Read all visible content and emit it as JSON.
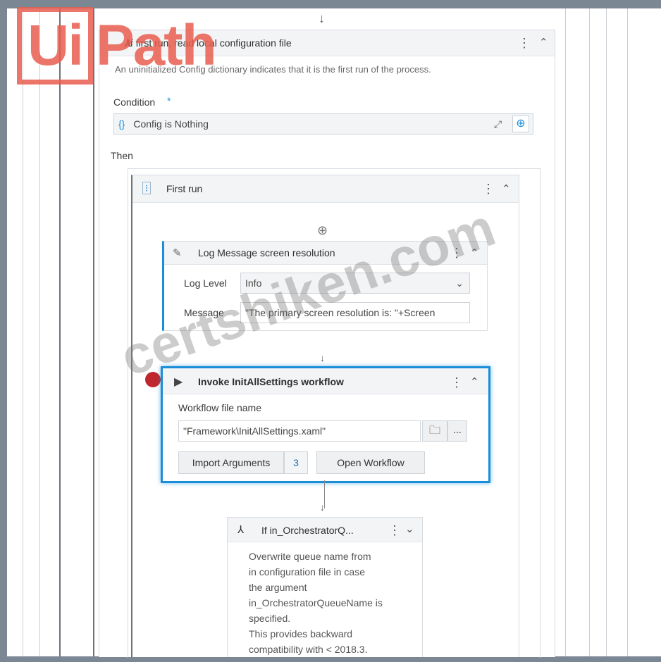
{
  "if_block": {
    "title": "If first run, read local configuration file",
    "description": "An uninitialized Config dictionary indicates that it is the first run of the process.",
    "condition_label": "Condition",
    "required_mark": "*",
    "condition_value": "Config is Nothing",
    "then_label": "Then"
  },
  "sequence": {
    "title": "First run"
  },
  "log_message": {
    "title": "Log Message screen resolution",
    "log_level_label": "Log Level",
    "log_level_value": "Info",
    "message_label": "Message",
    "message_value": "\"The primary screen resolution is: \"+Screen"
  },
  "invoke": {
    "title": "Invoke InitAllSettings workflow",
    "file_label": "Workflow file name",
    "file_value": "\"Framework\\InitAllSettings.xaml\"",
    "browse_label": "...",
    "import_label": "Import Arguments",
    "import_count": "3",
    "open_label": "Open Workflow"
  },
  "if_orchestrator": {
    "title": "If in_OrchestratorQ...",
    "description_lines": [
      "Overwrite queue name from",
      "in configuration file in case",
      "the argument",
      "in_OrchestratorQueueName is",
      "specified.",
      "This provides backward",
      "compatibility with < 2018.3."
    ]
  },
  "logo": {
    "ui": "Ui",
    "path": "Path"
  },
  "watermark": "certshiken.com",
  "colors": {
    "selection": "#1a8ed8",
    "breakpoint": "#c0262d",
    "logo": "#e85d4f",
    "frame": "#7c8794"
  }
}
